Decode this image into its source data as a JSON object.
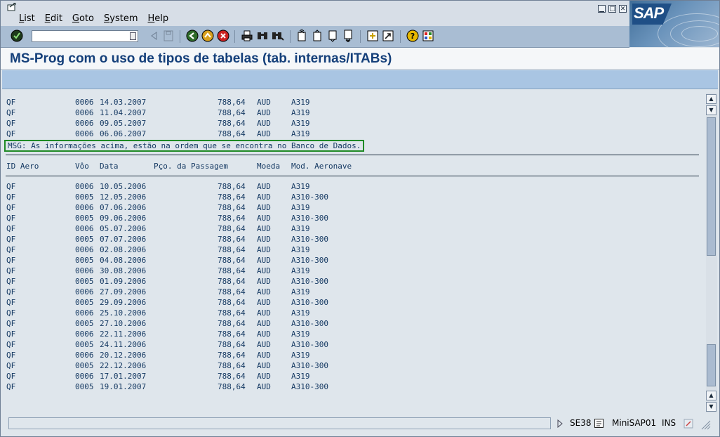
{
  "menu": {
    "items": [
      "List",
      "Edit",
      "Goto",
      "System",
      "Help"
    ]
  },
  "window_controls": {
    "minimize": "▁",
    "restore": "□",
    "close": "✕"
  },
  "logo": {
    "text": "SAP"
  },
  "toolbar": {
    "command_value": "",
    "icons": [
      "enter-icon",
      "back-disabled-icon",
      "save-disabled-icon",
      "back-icon",
      "exit-icon",
      "cancel-icon",
      "print-icon",
      "find-icon",
      "find-next-icon",
      "first-page-icon",
      "previous-page-icon",
      "next-page-icon",
      "last-page-icon",
      "new-session-icon",
      "shortcut-icon",
      "help-icon",
      "customize-layout-icon"
    ]
  },
  "page_title": "MS-Prog com o uso de tipos de tabelas (tab. internas/ITABs)",
  "list_top": [
    {
      "aero": "QF",
      "voo": "0006",
      "data": "14.03.2007",
      "preco": "788,64",
      "moeda": "AUD",
      "mod": "A319"
    },
    {
      "aero": "QF",
      "voo": "0006",
      "data": "11.04.2007",
      "preco": "788,64",
      "moeda": "AUD",
      "mod": "A319"
    },
    {
      "aero": "QF",
      "voo": "0006",
      "data": "09.05.2007",
      "preco": "788,64",
      "moeda": "AUD",
      "mod": "A319"
    },
    {
      "aero": "QF",
      "voo": "0006",
      "data": "06.06.2007",
      "preco": "788,64",
      "moeda": "AUD",
      "mod": "A319"
    }
  ],
  "message": "MSG: As informações acima, estão na ordem que se encontra no Banco de Dados.",
  "headers": {
    "aero": "ID Aero",
    "voo": "Vôo",
    "data": "Data",
    "preco": "Pço. da Passagem",
    "moeda": "Moeda",
    "mod": "Mod. Aeronave"
  },
  "list_main": [
    {
      "aero": "QF",
      "voo": "0006",
      "data": "10.05.2006",
      "preco": "788,64",
      "moeda": "AUD",
      "mod": "A319"
    },
    {
      "aero": "QF",
      "voo": "0005",
      "data": "12.05.2006",
      "preco": "788,64",
      "moeda": "AUD",
      "mod": "A310-300"
    },
    {
      "aero": "QF",
      "voo": "0006",
      "data": "07.06.2006",
      "preco": "788,64",
      "moeda": "AUD",
      "mod": "A319"
    },
    {
      "aero": "QF",
      "voo": "0005",
      "data": "09.06.2006",
      "preco": "788,64",
      "moeda": "AUD",
      "mod": "A310-300"
    },
    {
      "aero": "QF",
      "voo": "0006",
      "data": "05.07.2006",
      "preco": "788,64",
      "moeda": "AUD",
      "mod": "A319"
    },
    {
      "aero": "QF",
      "voo": "0005",
      "data": "07.07.2006",
      "preco": "788,64",
      "moeda": "AUD",
      "mod": "A310-300"
    },
    {
      "aero": "QF",
      "voo": "0006",
      "data": "02.08.2006",
      "preco": "788,64",
      "moeda": "AUD",
      "mod": "A319"
    },
    {
      "aero": "QF",
      "voo": "0005",
      "data": "04.08.2006",
      "preco": "788,64",
      "moeda": "AUD",
      "mod": "A310-300"
    },
    {
      "aero": "QF",
      "voo": "0006",
      "data": "30.08.2006",
      "preco": "788,64",
      "moeda": "AUD",
      "mod": "A319"
    },
    {
      "aero": "QF",
      "voo": "0005",
      "data": "01.09.2006",
      "preco": "788,64",
      "moeda": "AUD",
      "mod": "A310-300"
    },
    {
      "aero": "QF",
      "voo": "0006",
      "data": "27.09.2006",
      "preco": "788,64",
      "moeda": "AUD",
      "mod": "A319"
    },
    {
      "aero": "QF",
      "voo": "0005",
      "data": "29.09.2006",
      "preco": "788,64",
      "moeda": "AUD",
      "mod": "A310-300"
    },
    {
      "aero": "QF",
      "voo": "0006",
      "data": "25.10.2006",
      "preco": "788,64",
      "moeda": "AUD",
      "mod": "A319"
    },
    {
      "aero": "QF",
      "voo": "0005",
      "data": "27.10.2006",
      "preco": "788,64",
      "moeda": "AUD",
      "mod": "A310-300"
    },
    {
      "aero": "QF",
      "voo": "0006",
      "data": "22.11.2006",
      "preco": "788,64",
      "moeda": "AUD",
      "mod": "A319"
    },
    {
      "aero": "QF",
      "voo": "0005",
      "data": "24.11.2006",
      "preco": "788,64",
      "moeda": "AUD",
      "mod": "A310-300"
    },
    {
      "aero": "QF",
      "voo": "0006",
      "data": "20.12.2006",
      "preco": "788,64",
      "moeda": "AUD",
      "mod": "A319"
    },
    {
      "aero": "QF",
      "voo": "0005",
      "data": "22.12.2006",
      "preco": "788,64",
      "moeda": "AUD",
      "mod": "A310-300"
    },
    {
      "aero": "QF",
      "voo": "0006",
      "data": "17.01.2007",
      "preco": "788,64",
      "moeda": "AUD",
      "mod": "A319"
    },
    {
      "aero": "QF",
      "voo": "0005",
      "data": "19.01.2007",
      "preco": "788,64",
      "moeda": "AUD",
      "mod": "A310-300"
    }
  ],
  "status": {
    "transaction": "SE38",
    "system": "MiniSAP01",
    "mode": "INS"
  },
  "colors": {
    "title": "#143f7a",
    "list_text": "#163a63",
    "msg_border": "#1f8a26",
    "toolbar": "#a9bdd3",
    "appbar": "#a9c5e3"
  }
}
